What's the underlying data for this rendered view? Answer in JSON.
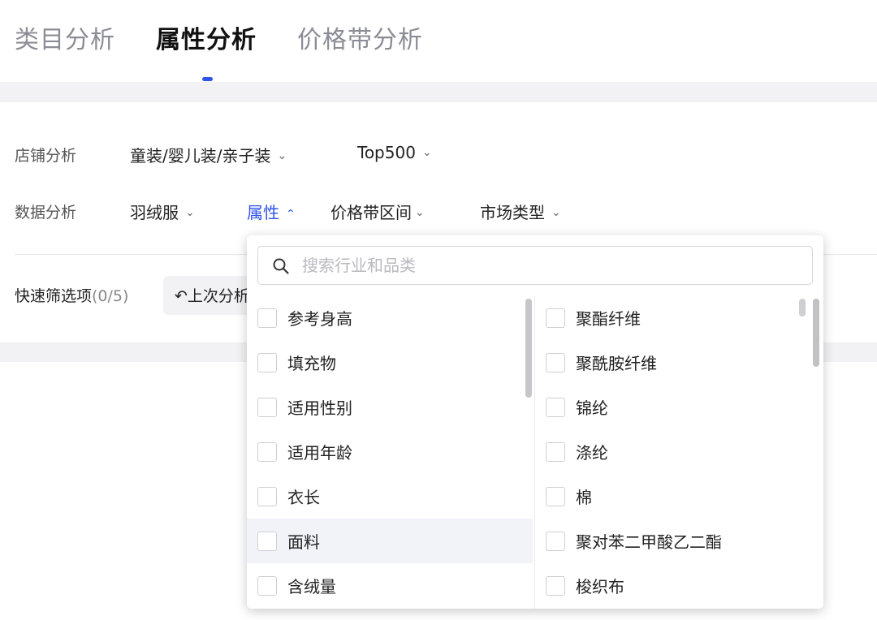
{
  "tabs": [
    {
      "label": "类目分析"
    },
    {
      "label": "属性分析"
    },
    {
      "label": "价格带分析"
    }
  ],
  "shop_row": {
    "label": "店铺分析",
    "category": "童装/婴儿装/亲子装",
    "rank": "Top500"
  },
  "data_row": {
    "label": "数据分析",
    "product": "羽绒服",
    "attribute": "属性",
    "price_band": "价格带区间",
    "market_type": "市场类型"
  },
  "quick_filter": {
    "label": "快速筛选项",
    "count": "(0/5)",
    "last_button": "↶上次分析"
  },
  "dropdown": {
    "search_placeholder": "搜索行业和品类",
    "left_items": [
      {
        "label": "参考身高"
      },
      {
        "label": "填充物"
      },
      {
        "label": "适用性别"
      },
      {
        "label": "适用年龄"
      },
      {
        "label": "衣长"
      },
      {
        "label": "面料"
      },
      {
        "label": "含绒量"
      }
    ],
    "right_items": [
      {
        "label": "聚酯纤维"
      },
      {
        "label": "聚酰胺纤维"
      },
      {
        "label": "锦纶"
      },
      {
        "label": "涤纶"
      },
      {
        "label": "棉"
      },
      {
        "label": "聚对苯二甲酸乙二酯"
      },
      {
        "label": "梭织布"
      }
    ]
  },
  "colors": {
    "accent": "#2f54eb",
    "highlight_row": "#f2f3f8",
    "gray_band": "#f2f2f4"
  }
}
